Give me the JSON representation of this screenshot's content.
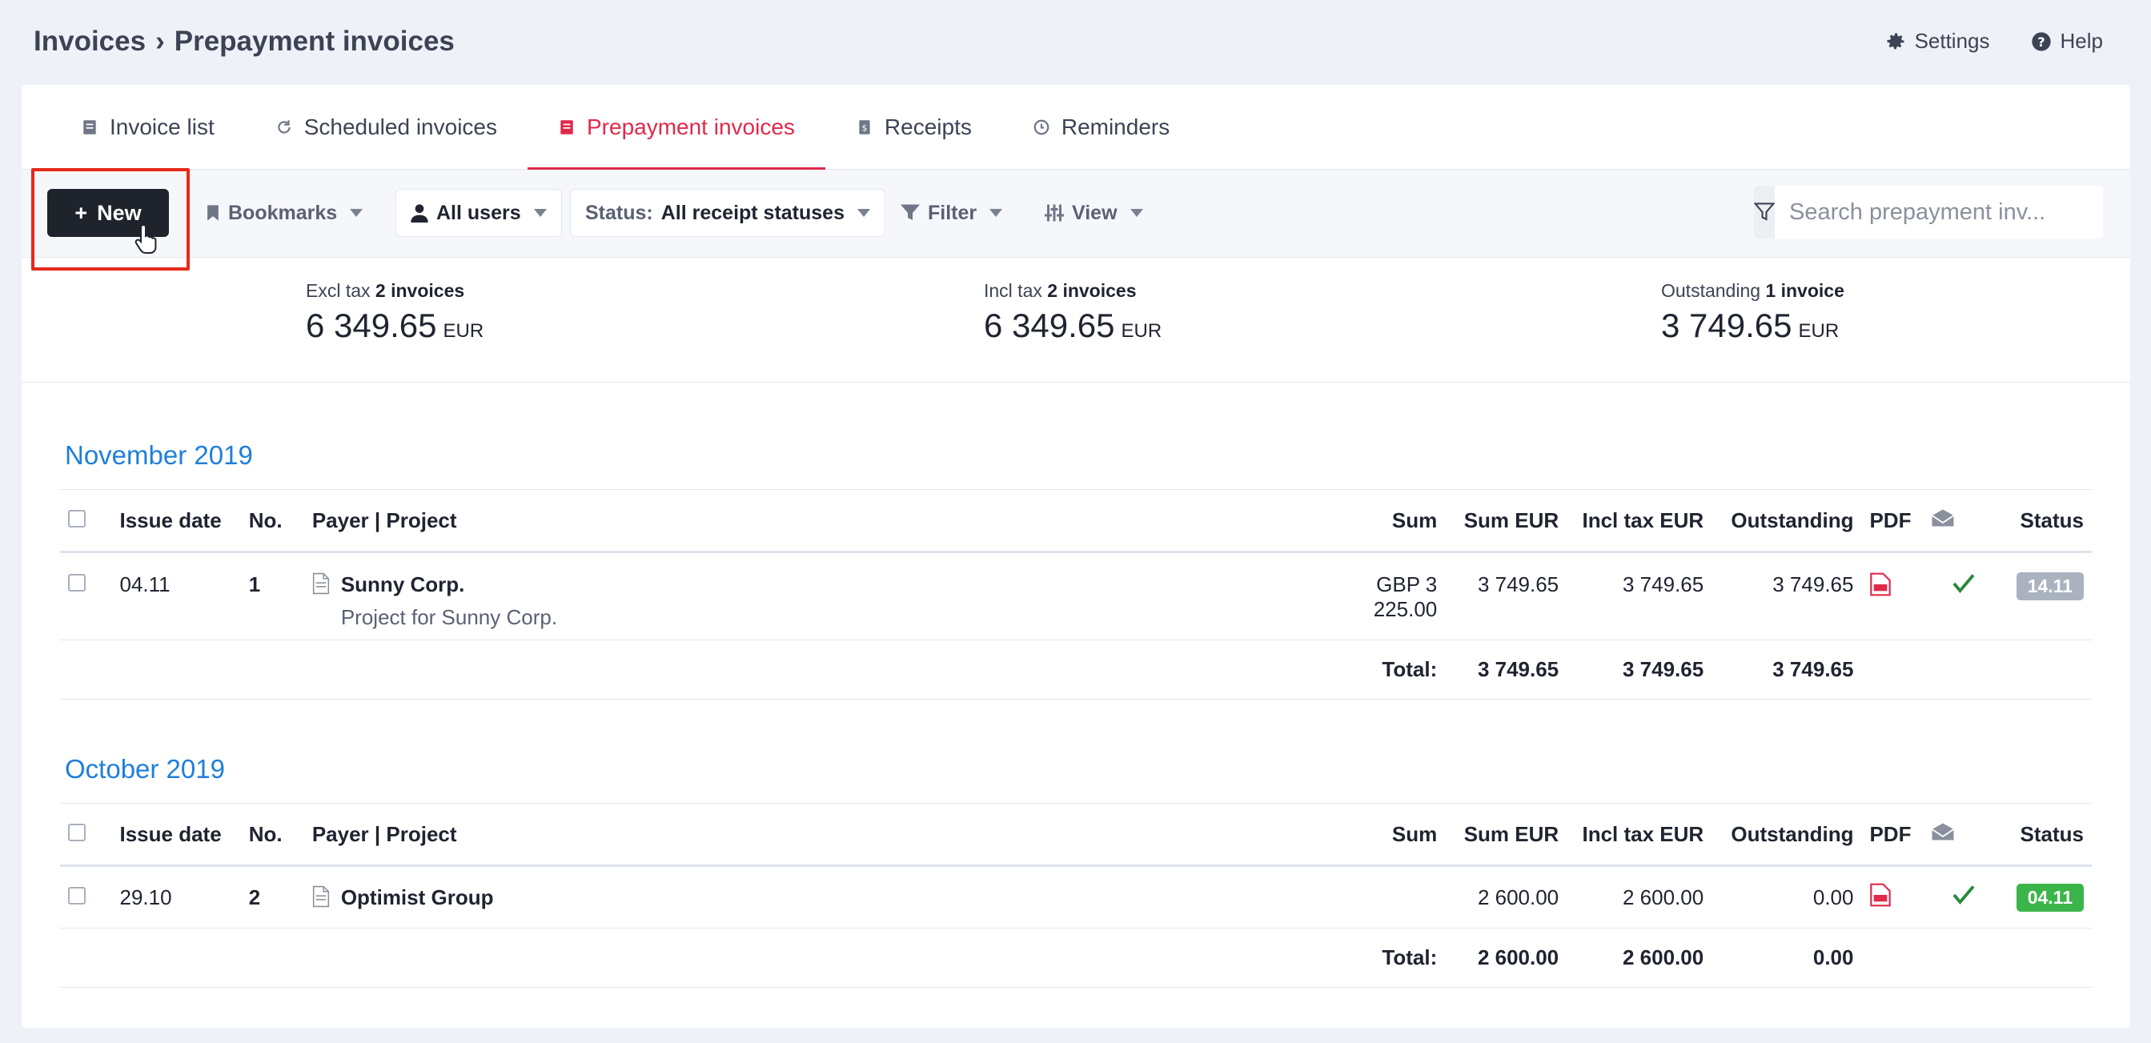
{
  "header": {
    "breadcrumb_root": "Invoices",
    "breadcrumb_sep": "›",
    "breadcrumb_current": "Prepayment invoices",
    "settings_label": "Settings",
    "help_label": "Help"
  },
  "tabs": [
    {
      "label": "Invoice list",
      "icon": "invoice-list-icon"
    },
    {
      "label": "Scheduled invoices",
      "icon": "refresh-icon"
    },
    {
      "label": "Prepayment invoices",
      "icon": "prepayment-icon",
      "active": true
    },
    {
      "label": "Receipts",
      "icon": "receipt-icon"
    },
    {
      "label": "Reminders",
      "icon": "clock-icon"
    }
  ],
  "toolbar": {
    "new_label": "New",
    "new_plus": "+",
    "bookmarks_label": "Bookmarks",
    "users_label": "All users",
    "status_prefix": "Status:",
    "status_value": "All receipt statuses",
    "filter_label": "Filter",
    "view_label": "View",
    "search_placeholder": "Search prepayment inv..."
  },
  "stats": {
    "excl": {
      "label": "Excl tax",
      "count": "2 invoices",
      "value": "6 349.65",
      "currency": "EUR"
    },
    "incl": {
      "label": "Incl tax",
      "count": "2 invoices",
      "value": "6 349.65",
      "currency": "EUR"
    },
    "outstanding": {
      "label": "Outstanding",
      "count": "1 invoice",
      "value": "3 749.65",
      "currency": "EUR"
    }
  },
  "columns": {
    "issue_date": "Issue date",
    "no": "No.",
    "payer": "Payer | Project",
    "sum": "Sum",
    "sum_eur": "Sum EUR",
    "incl_tax": "Incl tax EUR",
    "outstanding": "Outstanding",
    "pdf": "PDF",
    "status": "Status"
  },
  "sections": [
    {
      "title": "November 2019",
      "rows": [
        {
          "date": "04.11",
          "no": "1",
          "payer": "Sunny Corp.",
          "project": "Project for Sunny Corp.",
          "sum": "GBP 3 225.00",
          "sum_eur": "3 749.65",
          "incl": "3 749.65",
          "outstanding": "3 749.65",
          "status": "14.11",
          "status_color": "#aab2c0"
        }
      ],
      "total": {
        "label": "Total:",
        "sum_eur": "3 749.65",
        "incl": "3 749.65",
        "outstanding": "3 749.65"
      }
    },
    {
      "title": "October 2019",
      "rows": [
        {
          "date": "29.10",
          "no": "2",
          "payer": "Optimist Group",
          "project": "",
          "sum": "",
          "sum_eur": "2 600.00",
          "incl": "2 600.00",
          "outstanding": "0.00",
          "status": "04.11",
          "status_color": "#3bb54a"
        }
      ],
      "total": {
        "label": "Total:",
        "sum_eur": "2 600.00",
        "incl": "2 600.00",
        "outstanding": "0.00"
      }
    }
  ],
  "colors": {
    "accent": "#e0294b",
    "link": "#1f7fd8",
    "highlight": "#e52a1a"
  }
}
